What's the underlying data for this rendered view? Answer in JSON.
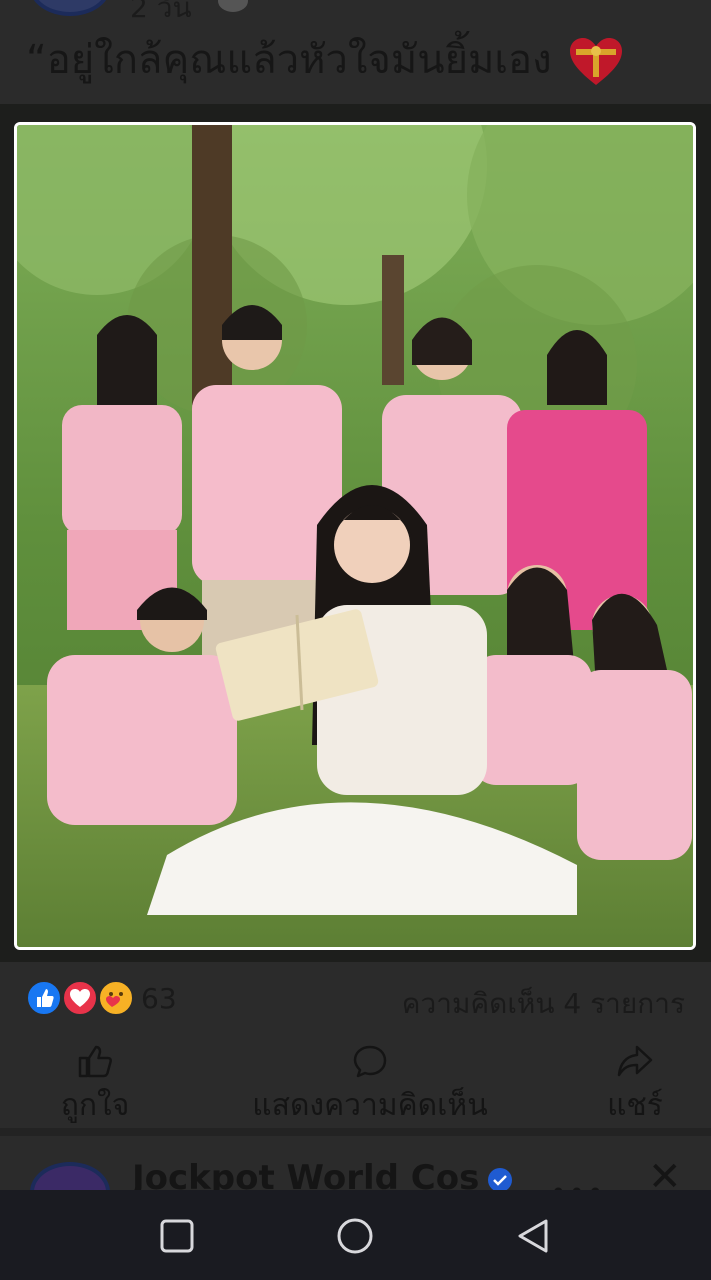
{
  "post": {
    "time": "2 วัน",
    "caption": "“อยู่ใกล้คุณแล้วหัวใจมันยิ้มเอง",
    "reaction_count": "63",
    "comment_count": "ความคิดเห็น 4 รายการ"
  },
  "actions": {
    "like_label": "ถูกใจ",
    "comment_label": "แสดงความคิดเห็น",
    "share_label": "แชร์"
  },
  "next_post": {
    "page_name": "Jockpot World Cos",
    "more_label": "•••",
    "close_label": "✕"
  },
  "icons": {
    "reactions": [
      "like-icon",
      "love-icon",
      "care-icon"
    ],
    "nav": [
      "recent-apps-icon",
      "home-icon",
      "back-icon"
    ]
  },
  "colors": {
    "background": "#2b2b2b",
    "like_blue": "#1877f2",
    "love_red": "#e8334a",
    "care_yellow": "#f7b125",
    "navbar": "#1a1b21"
  }
}
